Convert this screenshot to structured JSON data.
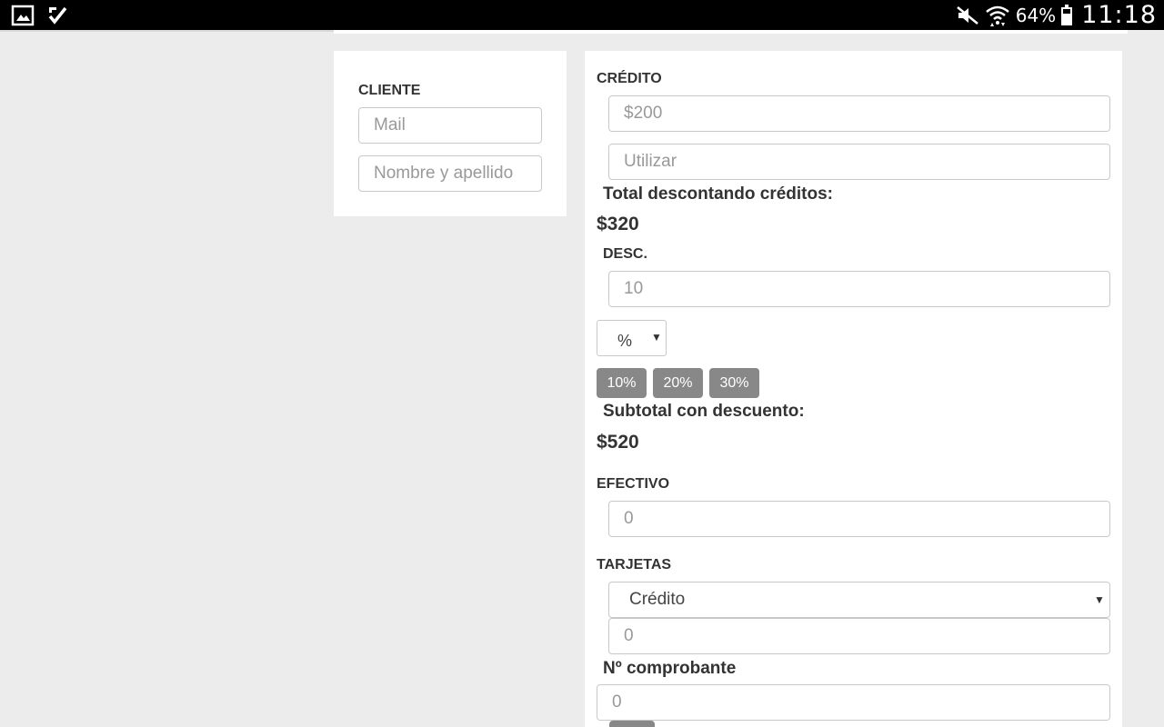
{
  "status_bar": {
    "battery_percent": "64%",
    "battery_level": 0.64,
    "time": "11:18",
    "icons": [
      "gallery-icon",
      "check-app-icon",
      "mute-icon",
      "wifi-icon",
      "battery-icon"
    ]
  },
  "client": {
    "label": "CLIENTE",
    "mail_placeholder": "Mail",
    "name_placeholder": "Nombre y apellido"
  },
  "credit": {
    "label": "CRÉDITO",
    "amount_placeholder": "$200",
    "use_placeholder": "Utilizar",
    "total_label": "Total descontando créditos:",
    "total_value": "$320"
  },
  "discount": {
    "label": "DESC.",
    "value_placeholder": "10",
    "type_selected": "%",
    "quick_buttons": [
      "10%",
      "20%",
      "30%"
    ],
    "subtotal_label": "Subtotal con descuento:",
    "subtotal_value": "$520"
  },
  "cash": {
    "label": "EFECTIVO",
    "placeholder": "0"
  },
  "cards": {
    "label": "TARJETAS",
    "type_selected": "Crédito",
    "amount_placeholder": "0"
  },
  "receipt": {
    "label": "Nº comprobante",
    "placeholder": "0"
  },
  "colors": {
    "background": "#ececec",
    "card": "#ffffff",
    "button": "#888888",
    "text": "#333333",
    "placeholder": "#999999",
    "input_border": "#c9c9c9"
  }
}
